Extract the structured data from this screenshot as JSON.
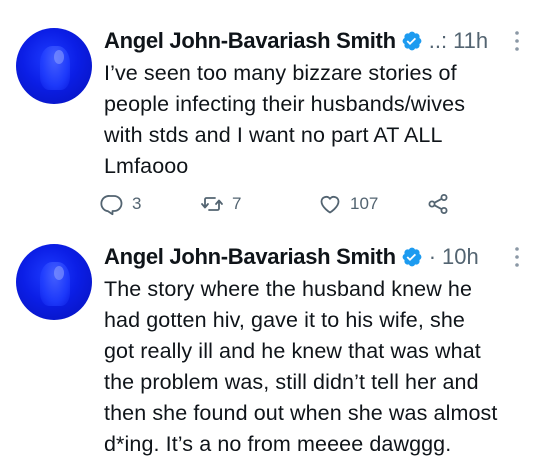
{
  "colors": {
    "text_primary": "#0f1419",
    "text_secondary": "#536471",
    "verified_blue": "#1d9bf0",
    "avatar_blue": "#0b1ee6"
  },
  "tweets": [
    {
      "display_name": "Angel John-Bavariash Smith",
      "separator": "..:",
      "timestamp": "11h",
      "text": "I’ve seen too many bizzare stories of\npeople infecting their husbands/wives\nwith stds and I want no part AT ALL\nLmfaooo",
      "actions": {
        "reply_count": "3",
        "retweet_count": "7",
        "like_count": "107"
      },
      "icons": [
        "verified-badge-icon",
        "more-options-icon",
        "reply-icon",
        "retweet-icon",
        "like-icon",
        "share-icon"
      ]
    },
    {
      "display_name": "Angel John-Bavariash Smith",
      "separator": "·",
      "timestamp": "10h",
      "text": "The story where the husband knew he\nhad gotten hiv, gave it to his wife, she\ngot really ill and he knew that was what\nthe problem was, still didn’t tell her and\nthen she found out when she was almost\nd*ing. It’s a no from meeee dawggg.",
      "icons": [
        "verified-badge-icon",
        "more-options-icon"
      ]
    }
  ]
}
